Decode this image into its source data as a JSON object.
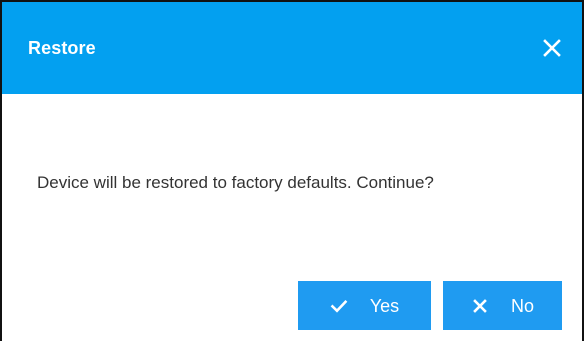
{
  "dialog": {
    "title": "Restore",
    "close_icon": "close-icon",
    "message": "Device will be restored to factory defaults. Continue?",
    "buttons": {
      "yes": {
        "label": "Yes",
        "icon": "check-icon"
      },
      "no": {
        "label": "No",
        "icon": "close-icon"
      }
    },
    "colors": {
      "header": "#03a0f0",
      "button": "#1f9bf1",
      "text": "#333333"
    }
  }
}
